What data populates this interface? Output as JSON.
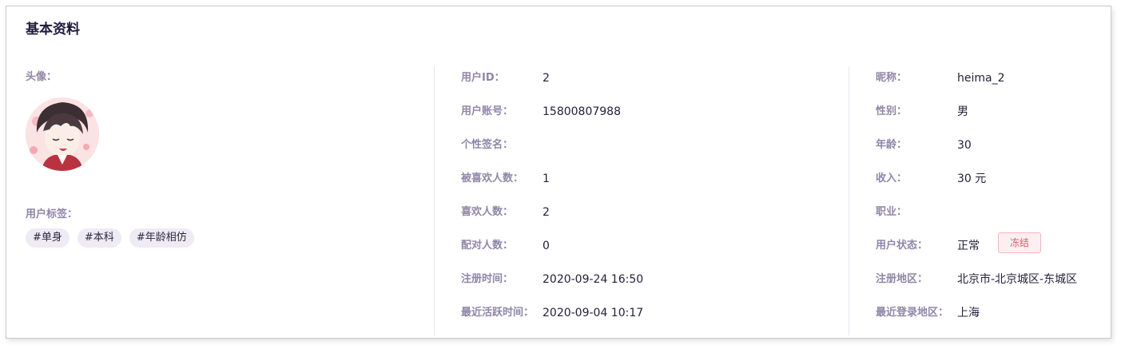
{
  "section_title": "基本资料",
  "avatar_label": "头像：",
  "tags_label": "用户标签：",
  "tags": [
    "#单身",
    "#本科",
    "#年龄相仿"
  ],
  "middle": [
    {
      "label": "用户ID：",
      "value": "2"
    },
    {
      "label": "用户账号：",
      "value": "15800807988"
    },
    {
      "label": "个性签名：",
      "value": ""
    },
    {
      "label": "被喜欢人数：",
      "value": "1"
    },
    {
      "label": "喜欢人数：",
      "value": "2"
    },
    {
      "label": "配对人数：",
      "value": "0"
    },
    {
      "label": "注册时间：",
      "value": "2020-09-24 16:50"
    },
    {
      "label": "最近活跃时间：",
      "value": "2020-09-04 10:17"
    }
  ],
  "right": [
    {
      "label": "昵称：",
      "value": "heima_2"
    },
    {
      "label": "性别：",
      "value": "男"
    },
    {
      "label": "年龄：",
      "value": "30"
    },
    {
      "label": "收入：",
      "value": "30 元"
    },
    {
      "label": "职业：",
      "value": ""
    },
    {
      "label": "用户状态：",
      "value": "正常"
    },
    {
      "label": "注册地区：",
      "value": "北京市-北京城区-东城区"
    },
    {
      "label": "最近登录地区：",
      "value": "上海"
    }
  ],
  "freeze_button": "冻结",
  "colors": {
    "label": "#8e86a8",
    "value": "#24213a",
    "tag_bg": "#eeebf4",
    "freeze_text": "#e0596c",
    "freeze_bg": "#fdeff1"
  },
  "icons": {
    "avatar": "anime-avatar-image"
  }
}
